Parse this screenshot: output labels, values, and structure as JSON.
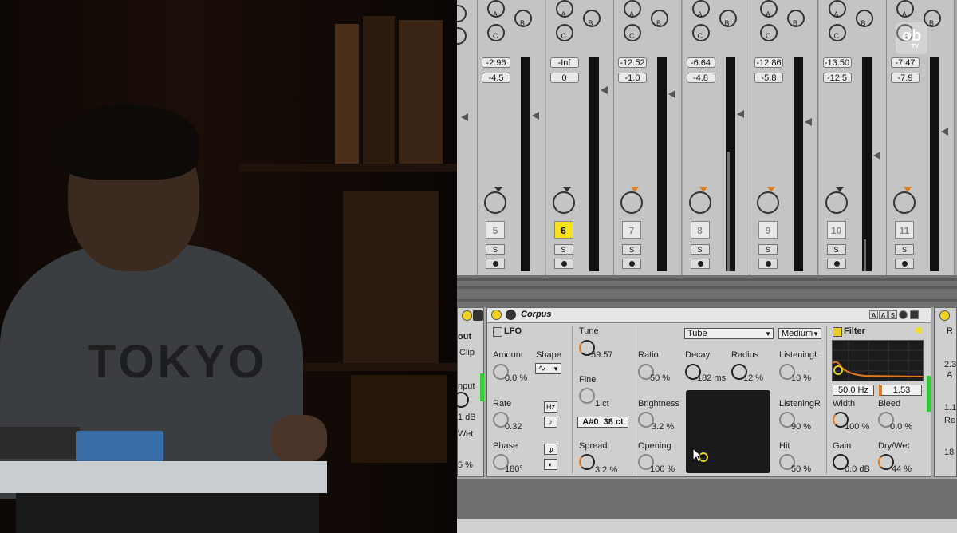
{
  "overlay": {
    "logo_text": "ob",
    "logo_sub": "TV"
  },
  "photo": {
    "shirt_text": "TOKYO"
  },
  "mixer": {
    "send_labels": [
      "A",
      "B",
      "C"
    ],
    "tracks": [
      {
        "number": "5",
        "volume": "-2.96",
        "peak": "-4.5",
        "solo": "S",
        "active": false,
        "pan_orange": false
      },
      {
        "number": "6",
        "volume": "-Inf",
        "peak": "0",
        "solo": "S",
        "active": true,
        "pan_orange": false
      },
      {
        "number": "7",
        "volume": "-12.52",
        "peak": "-1.0",
        "solo": "S",
        "active": false,
        "pan_orange": true
      },
      {
        "number": "8",
        "volume": "-6.64",
        "peak": "-4.8",
        "solo": "S",
        "active": false,
        "pan_orange": true
      },
      {
        "number": "9",
        "volume": "-12.86",
        "peak": "-5.8",
        "solo": "S",
        "active": false,
        "pan_orange": true
      },
      {
        "number": "10",
        "volume": "-13.50",
        "peak": "-12.5",
        "solo": "S",
        "active": false,
        "pan_orange": false
      },
      {
        "number": "11",
        "volume": "-7.47",
        "peak": "-7.9",
        "solo": "S",
        "active": false,
        "pan_orange": true
      }
    ]
  },
  "left_device": {
    "label_out": "out",
    "label_clip": "Clip",
    "label_input": "nput",
    "value_db": "1 dB",
    "label_wet": "Wet",
    "value_pct": "5 %"
  },
  "corpus": {
    "name": "Corpus",
    "header_buttons": [
      "A",
      "A",
      "S"
    ],
    "lfo": {
      "title": "LFO",
      "amount_label": "Amount",
      "amount_value": "0.0 %",
      "shape_label": "Shape",
      "rate_label": "Rate",
      "rate_value": "0.32",
      "hz_button": "Hz",
      "note_button": "♪",
      "phase_label": "Phase",
      "phase_value": "180°",
      "phase_btn1": "φ",
      "phase_btn2": "◐"
    },
    "tune": {
      "tune_label": "Tune",
      "tune_value": "59.57",
      "fine_label": "Fine",
      "fine_value": "1 ct",
      "note_value": "A#0",
      "cents_value": "38",
      "cents_unit": "ct",
      "spread_label": "Spread",
      "spread_value": "3.2 %"
    },
    "resonator": {
      "type_select": "Tube",
      "quality_select": "Medium",
      "ratio_label": "Ratio",
      "ratio_value": "50 %",
      "decay_label": "Decay",
      "decay_value": "182 ms",
      "radius_label": "Radius",
      "radius_value": "12 %",
      "brightness_label": "Brightness",
      "brightness_value": "3.2 %",
      "opening_label": "Opening",
      "opening_value": "100 %",
      "listening_l_label": "ListeningL",
      "listening_l_value": "10 %",
      "listening_r_label": "ListeningR",
      "listening_r_value": "90 %",
      "hit_label": "Hit",
      "hit_value": "50 %"
    },
    "filter": {
      "title": "Filter",
      "freq_value": "50.0 Hz",
      "q_value": "1.53",
      "width_label": "Width",
      "width_value": "100 %",
      "bleed_label": "Bleed",
      "bleed_value": "0.0 %",
      "gain_label": "Gain",
      "gain_value": "0.0 dB",
      "drywet_label": "Dry/Wet",
      "drywet_value": "44 %"
    }
  },
  "right_device": {
    "label_r": "R",
    "value_1": "2.3",
    "label_a": "A",
    "value_2": "1.1",
    "label_re": "Re",
    "value_3": "18"
  },
  "colors": {
    "accent_orange": "#e07a1c",
    "accent_yellow": "#f5e21a"
  }
}
